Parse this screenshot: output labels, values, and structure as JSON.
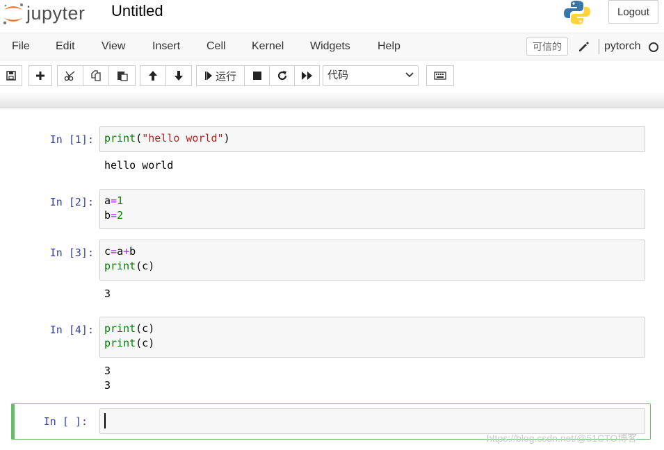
{
  "header": {
    "logo_text": "jupyter",
    "notebook_title": "Untitled",
    "logout_label": "Logout"
  },
  "menubar": {
    "items": [
      "File",
      "Edit",
      "View",
      "Insert",
      "Cell",
      "Kernel",
      "Widgets",
      "Help"
    ],
    "trusted_label": "可信的",
    "kernel_name": "pytorch"
  },
  "toolbar": {
    "run_label": "运行",
    "cell_type": "代码"
  },
  "cells": [
    {
      "prompt": "In  [1]:",
      "output": "hello world"
    },
    {
      "prompt": "In  [2]:",
      "output": ""
    },
    {
      "prompt": "In  [3]:",
      "output": "3"
    },
    {
      "prompt": "In  [4]:",
      "output": "3\n3"
    },
    {
      "prompt": "In  [ ]:",
      "output": ""
    }
  ],
  "watermark": "https://blog.csdn.net/@51CTO博客",
  "colors": {
    "prompt": "#303f9f",
    "keyword": "#008000",
    "string": "#ba2121",
    "operator": "#aa22ff",
    "selected_border": "#66bb6a"
  }
}
